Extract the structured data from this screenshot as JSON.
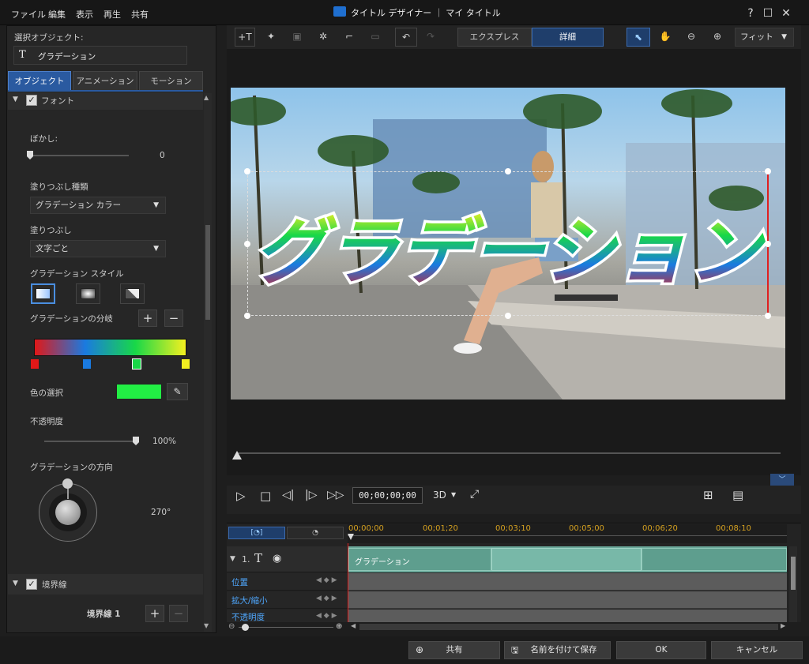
{
  "menu": {
    "file": "ファイル",
    "edit": "編集",
    "view": "表示",
    "play": "再生",
    "share": "共有"
  },
  "window": {
    "title": "タイトル デザイナー ｜ マイ タイトル",
    "help": "?"
  },
  "object_panel": {
    "label": "選択オブジェクト:",
    "selected_object": "グラデーション",
    "tabs": [
      "オブジェクト",
      "アニメーション",
      "モーション"
    ],
    "font_section": "フォント",
    "blur_label": "ぼかし:",
    "blur_value": "0",
    "blur_level": 0,
    "fill_type_label": "塗りつぶし種類",
    "fill_type_value": "グラデーション カラー",
    "fill_label": "塗りつぶし",
    "fill_value": "文字ごと",
    "gradient_style_label": "グラデーション スタイル",
    "gradient_branch_label": "グラデーションの分岐",
    "gradient_stops": [
      "#e01818",
      "#1a7ae0",
      "#18d848",
      "#f4f020"
    ],
    "color_select_label": "色の選択",
    "selected_color": "#22ee44",
    "opacity_label": "不透明度",
    "opacity_value": "100%",
    "opacity_level": 1.0,
    "direction_label": "グラデーションの方向",
    "direction_value": "270°",
    "border_section": "境界線",
    "border_item": "境界線 1"
  },
  "toolbar": {
    "mode_express": "エクスプレス",
    "mode_detail": "詳細",
    "zoom_fit": "フィット"
  },
  "preview": {
    "title_text": "グラデーション"
  },
  "playback": {
    "timecode": "00;00;00;00",
    "mode_3d": "3D",
    "position": 0.0
  },
  "timeline": {
    "ruler": [
      "00;00;00",
      "00;01;20",
      "00;03;10",
      "00;05;00",
      "00;06;20",
      "00;08;10"
    ],
    "track_number": "1.",
    "clip_label": "グラデーション",
    "properties": [
      "位置",
      "拡大/縮小",
      "不透明度"
    ]
  },
  "footer": {
    "share": "共有",
    "save_as": "名前を付けて保存",
    "ok": "OK",
    "cancel": "キャンセル"
  }
}
